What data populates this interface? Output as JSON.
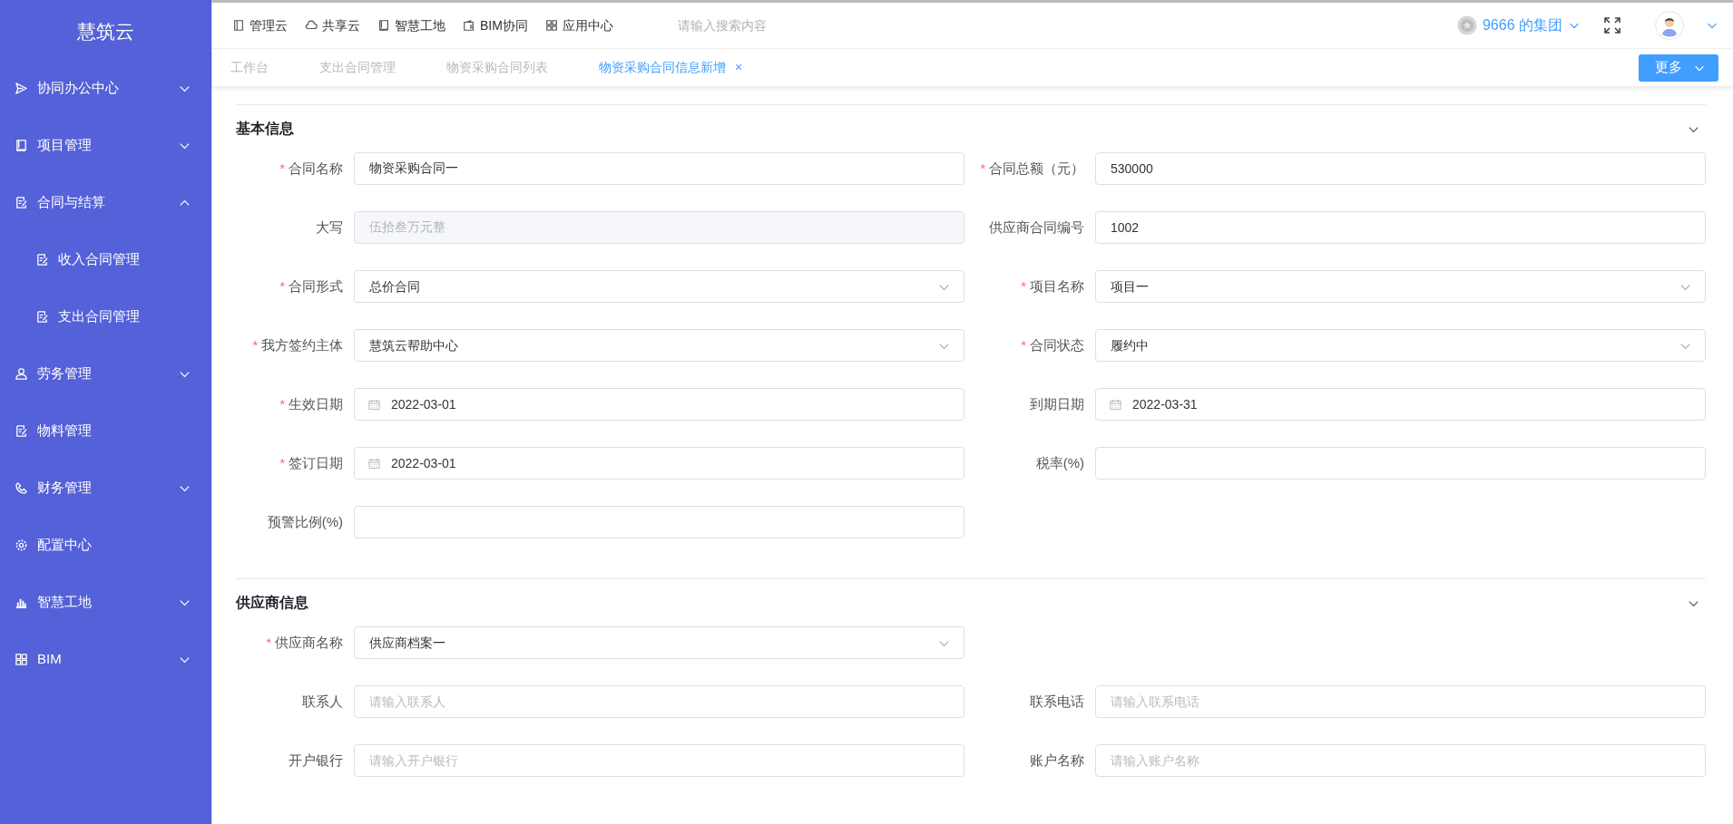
{
  "sidebar": {
    "logo": "慧筑云",
    "items": [
      {
        "label": "协同办公中心",
        "expanded": false
      },
      {
        "label": "项目管理",
        "expanded": false
      },
      {
        "label": "合同与结算",
        "expanded": true,
        "children": [
          {
            "label": "收入合同管理"
          },
          {
            "label": "支出合同管理"
          }
        ]
      },
      {
        "label": "劳务管理",
        "expanded": false
      },
      {
        "label": "物料管理"
      },
      {
        "label": "财务管理",
        "expanded": false
      },
      {
        "label": "配置中心"
      },
      {
        "label": "智慧工地",
        "expanded": false
      },
      {
        "label": "BIM",
        "expanded": false
      }
    ]
  },
  "topnav": {
    "items": [
      {
        "label": "管理云"
      },
      {
        "label": "共享云"
      },
      {
        "label": "智慧工地"
      },
      {
        "label": "BIM协同"
      },
      {
        "label": "应用中心"
      }
    ],
    "search": {
      "placeholder": "请输入搜索内容"
    },
    "group": "9666 的集团"
  },
  "tabs": [
    {
      "label": "工作台",
      "selected": false
    },
    {
      "label": "支出合同管理",
      "selected": false
    },
    {
      "label": "物资采购合同列表",
      "selected": false
    },
    {
      "label": "物资采购合同信息新增",
      "selected": true,
      "close": "×"
    }
  ],
  "more_button": "更多",
  "sections": [
    {
      "title": "基本信息",
      "expanded": true,
      "rows": [
        [
          {
            "label": "合同名称",
            "required_mark": "*",
            "kind": "text",
            "value": "物资采购合同一"
          },
          {
            "label": "合同总额（元）",
            "required_mark": "*",
            "kind": "text",
            "value": "530000"
          }
        ],
        [
          {
            "label": "大写",
            "kind": "readonly",
            "value": "伍拾叁万元整"
          },
          {
            "label": "供应商合同编号",
            "kind": "text",
            "value": "1002"
          }
        ],
        [
          {
            "label": "合同形式",
            "required_mark": "*",
            "kind": "select",
            "value": "总价合同"
          },
          {
            "label": "项目名称",
            "required_mark": "*",
            "kind": "select",
            "value": "项目一"
          }
        ],
        [
          {
            "label": "我方签约主体",
            "required_mark": "*",
            "kind": "select",
            "value": "慧筑云帮助中心"
          },
          {
            "label": "合同状态",
            "required_mark": "*",
            "kind": "select",
            "value": "履约中"
          }
        ],
        [
          {
            "label": "生效日期",
            "required_mark": "*",
            "kind": "date",
            "value": "2022-03-01"
          },
          {
            "label": "到期日期",
            "kind": "date",
            "value": "2022-03-31"
          }
        ],
        [
          {
            "label": "签订日期",
            "required_mark": "*",
            "kind": "date",
            "value": "2022-03-01"
          },
          {
            "label": "税率(%)",
            "kind": "text"
          }
        ],
        [
          {
            "label": "预警比例(%)",
            "kind": "text"
          }
        ]
      ]
    },
    {
      "title": "供应商信息",
      "expanded": true,
      "rows": [
        [
          {
            "label": "供应商名称",
            "required_mark": "*",
            "kind": "select",
            "value": "供应商档案一"
          }
        ],
        [
          {
            "label": "联系人",
            "kind": "text",
            "placeholder": "请输入联系人"
          },
          {
            "label": "联系电话",
            "kind": "text",
            "placeholder": "请输入联系电话"
          }
        ],
        [
          {
            "label": "开户银行",
            "kind": "text",
            "placeholder": "请输入开户银行"
          },
          {
            "label": "账户名称",
            "kind": "text",
            "placeholder": "请输入账户名称"
          }
        ]
      ]
    }
  ]
}
